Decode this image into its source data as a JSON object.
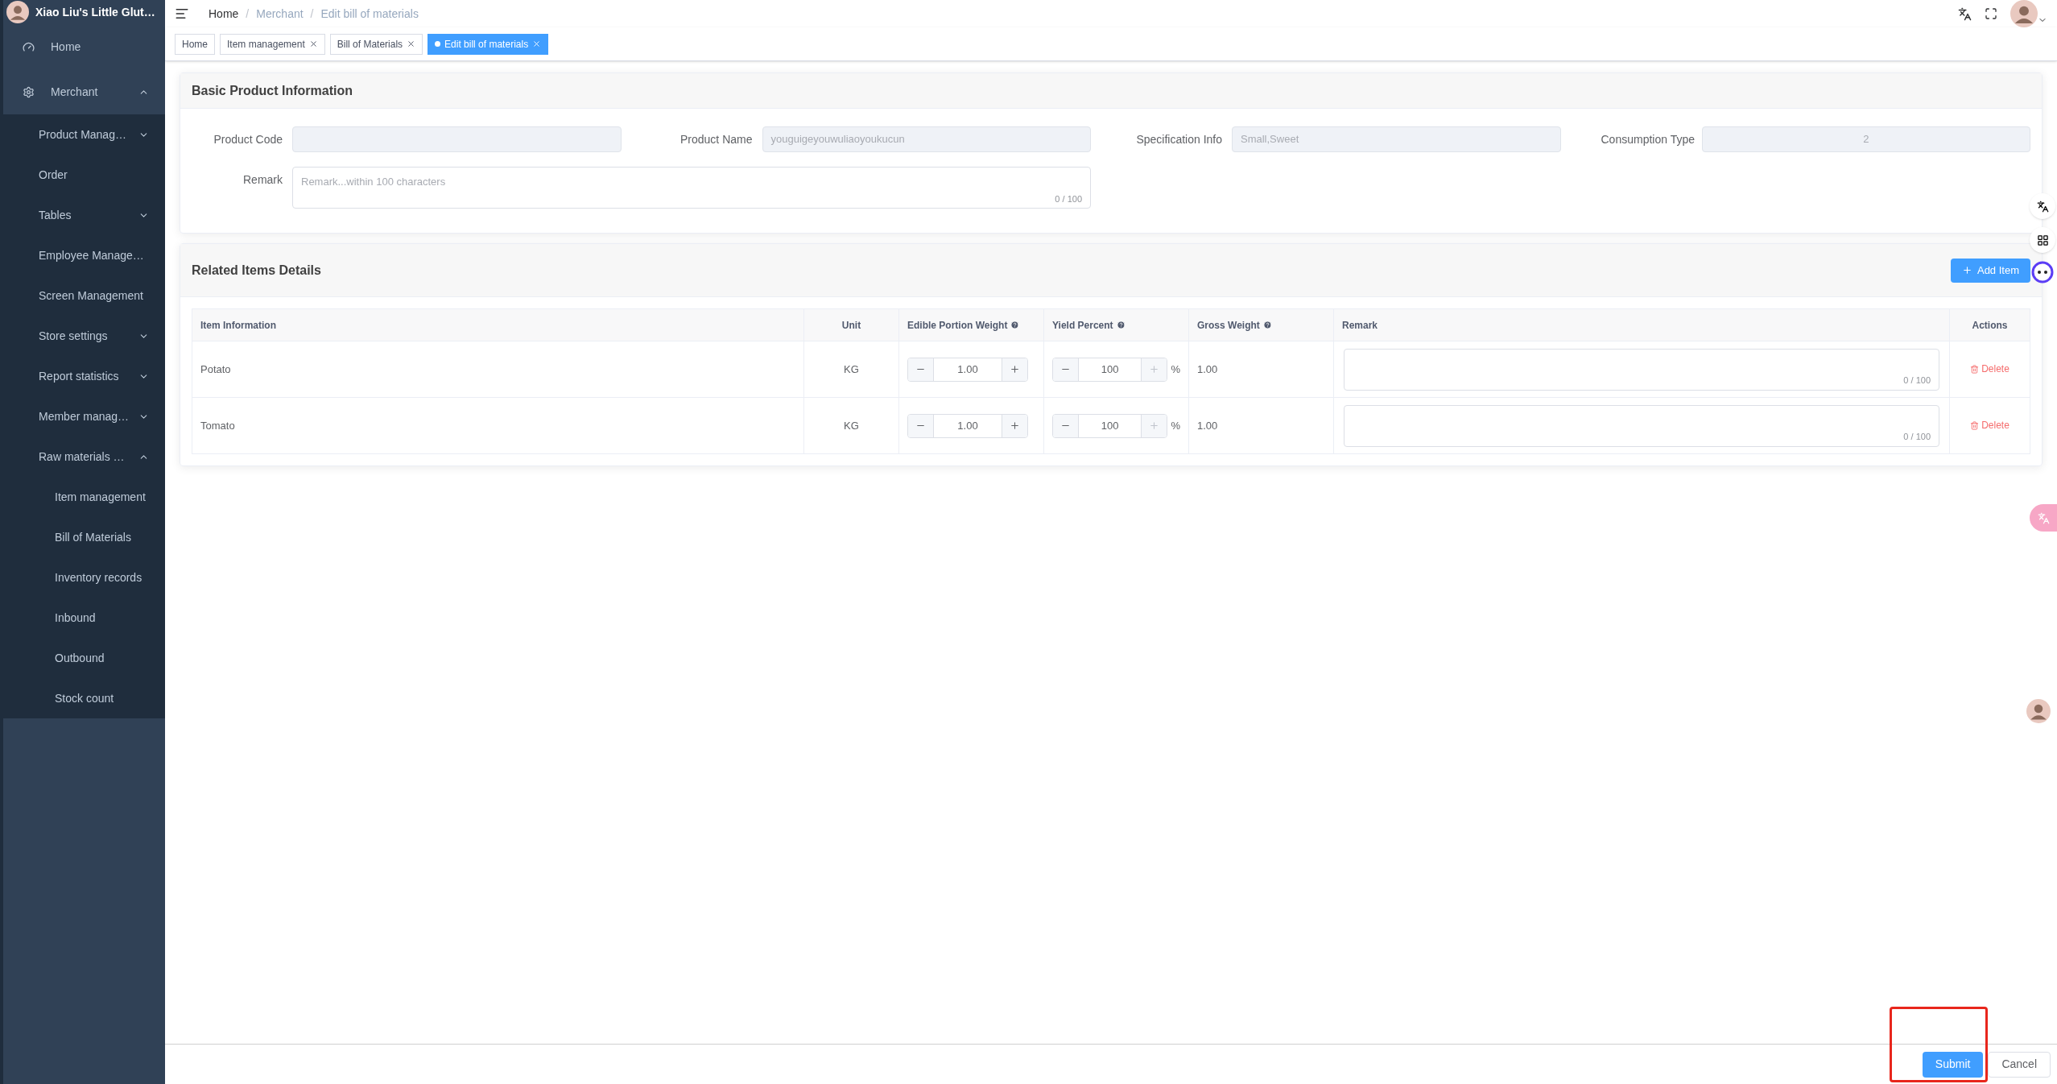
{
  "sidebar": {
    "brand": "Xiao Liu's Little Glut…",
    "items": [
      {
        "label": "Home"
      },
      {
        "label": "Merchant",
        "expanded": true,
        "children": [
          {
            "label": "Product Manag…",
            "expanded": false
          },
          {
            "label": "Order"
          },
          {
            "label": "Tables",
            "expanded": false
          },
          {
            "label": "Employee Manage…"
          },
          {
            "label": "Screen Management"
          },
          {
            "label": "Store settings",
            "expanded": false
          },
          {
            "label": "Report statistics",
            "expanded": false
          },
          {
            "label": "Member manag…",
            "expanded": false
          },
          {
            "label": "Raw materials …",
            "expanded": true,
            "children": [
              {
                "label": "Item management"
              },
              {
                "label": "Bill of Materials"
              },
              {
                "label": "Inventory records"
              },
              {
                "label": "Inbound"
              },
              {
                "label": "Outbound"
              },
              {
                "label": "Stock count"
              }
            ]
          }
        ]
      }
    ]
  },
  "breadcrumb": {
    "separator": "/",
    "items": [
      "Home",
      "Merchant",
      "Edit bill of materials"
    ]
  },
  "tags": [
    {
      "label": "Home",
      "closable": false,
      "selected": false
    },
    {
      "label": "Item management",
      "closable": true,
      "selected": false
    },
    {
      "label": "Bill of Materials",
      "closable": true,
      "selected": false
    },
    {
      "label": "Edit bill of materials",
      "closable": true,
      "selected": true
    }
  ],
  "basic_info": {
    "title": "Basic Product Information",
    "fields": [
      {
        "label": "Product Code",
        "disabled": true
      },
      {
        "label": "Product Name",
        "value": "youguigeyouwuliaoyoukucun",
        "disabled": true
      },
      {
        "label": "Specification Info",
        "value": "Small,Sweet",
        "disabled": true
      },
      {
        "label": "Consumption Type",
        "value": "2",
        "disabled": true
      }
    ],
    "remark": {
      "label": "Remark",
      "placeholder": "Remark...within 100 characters",
      "counter": "0 / 100"
    }
  },
  "related_items": {
    "title": "Related Items Details",
    "add_button": "Add Item",
    "columns": [
      {
        "label": "Item Information",
        "help": false
      },
      {
        "label": "Unit",
        "help": false
      },
      {
        "label": "Edible Portion Weight",
        "help": true
      },
      {
        "label": "Yield Percent",
        "help": true
      },
      {
        "label": "Gross Weight",
        "help": true
      },
      {
        "label": "Remark",
        "help": false
      },
      {
        "label": "Actions",
        "help": false
      }
    ],
    "rows": [
      {
        "item": "Potato",
        "unit": "KG",
        "edible": "1.00",
        "edible_plus_disabled": false,
        "yield": "100",
        "yield_plus_disabled": true,
        "yield_unit": "%",
        "gross": "1.00",
        "remark_counter": "0 / 100",
        "action": "Delete"
      },
      {
        "item": "Tomato",
        "unit": "KG",
        "edible": "1.00",
        "edible_plus_disabled": false,
        "yield": "100",
        "yield_plus_disabled": true,
        "yield_unit": "%",
        "gross": "1.00",
        "remark_counter": "0 / 100",
        "action": "Delete"
      }
    ]
  },
  "footer": {
    "buttons": [
      {
        "label": "Submit",
        "kind": "primary",
        "highlighted": true
      },
      {
        "label": "Cancel",
        "kind": "default",
        "highlighted": false
      }
    ]
  }
}
